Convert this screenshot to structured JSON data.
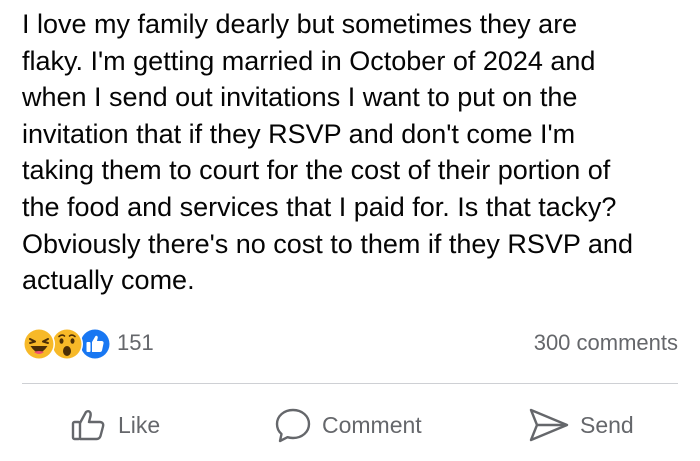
{
  "post": {
    "lines": [
      "I love my family dearly but sometimes they are",
      "flaky. I'm getting married in October of 2024 and",
      "when I send out invitations I want to put on the",
      "invitation that if they RSVP and don't come I'm",
      "taking them to court for the cost of their portion of",
      "the food and services that I paid for. Is that tacky?",
      "Obviously there's no cost to them if they RSVP and",
      "actually come."
    ]
  },
  "reactions": {
    "icons": [
      "laughing-emoji-icon",
      "wow-emoji-icon",
      "like-thumb-icon"
    ],
    "count": "151"
  },
  "comments": {
    "count_label": "300 comments"
  },
  "actions": {
    "like_label": "Like",
    "comment_label": "Comment",
    "send_label": "Send"
  },
  "colors": {
    "text": "#050505",
    "secondary_text": "#65676b",
    "like_blue": "#1877f2",
    "emoji_yellow": "#f7b928"
  }
}
